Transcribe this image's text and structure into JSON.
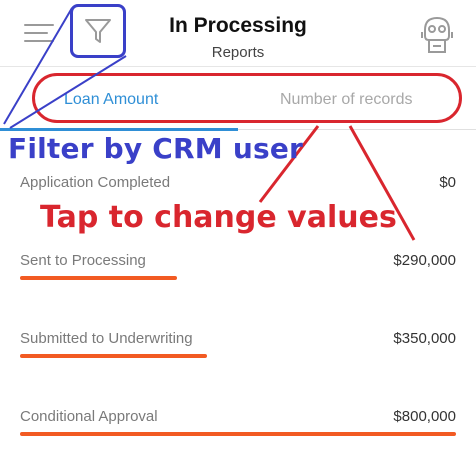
{
  "header": {
    "title": "In Processing",
    "subtitle": "Reports"
  },
  "icons": {
    "menu": "hamburger-menu-icon",
    "filter": "funnel-filter-icon",
    "avatar": "robot-avatar-icon"
  },
  "tabs": [
    {
      "label": "Loan Amount",
      "active": true
    },
    {
      "label": "Number of records",
      "active": false
    }
  ],
  "annotations": {
    "filter_note": "Filter by CRM user",
    "tap_note": "Tap to change values"
  },
  "rows": [
    {
      "label": "Application Completed",
      "value": "$0"
    },
    {
      "label": "Sent to Processing",
      "value": "$290,000"
    },
    {
      "label": "Submitted to Underwriting",
      "value": "$350,000"
    },
    {
      "label": "Conditional Approval",
      "value": "$800,000"
    }
  ],
  "bars": {
    "sent_to_processing": 0.36,
    "submitted_to_underwriting": 0.43,
    "conditional_approval": 1.0
  },
  "colors": {
    "accent_blue": "#2f8fd6",
    "annotation_blue": "#3a40c8",
    "annotation_red": "#d9262e",
    "bar_orange": "#f25a22"
  }
}
